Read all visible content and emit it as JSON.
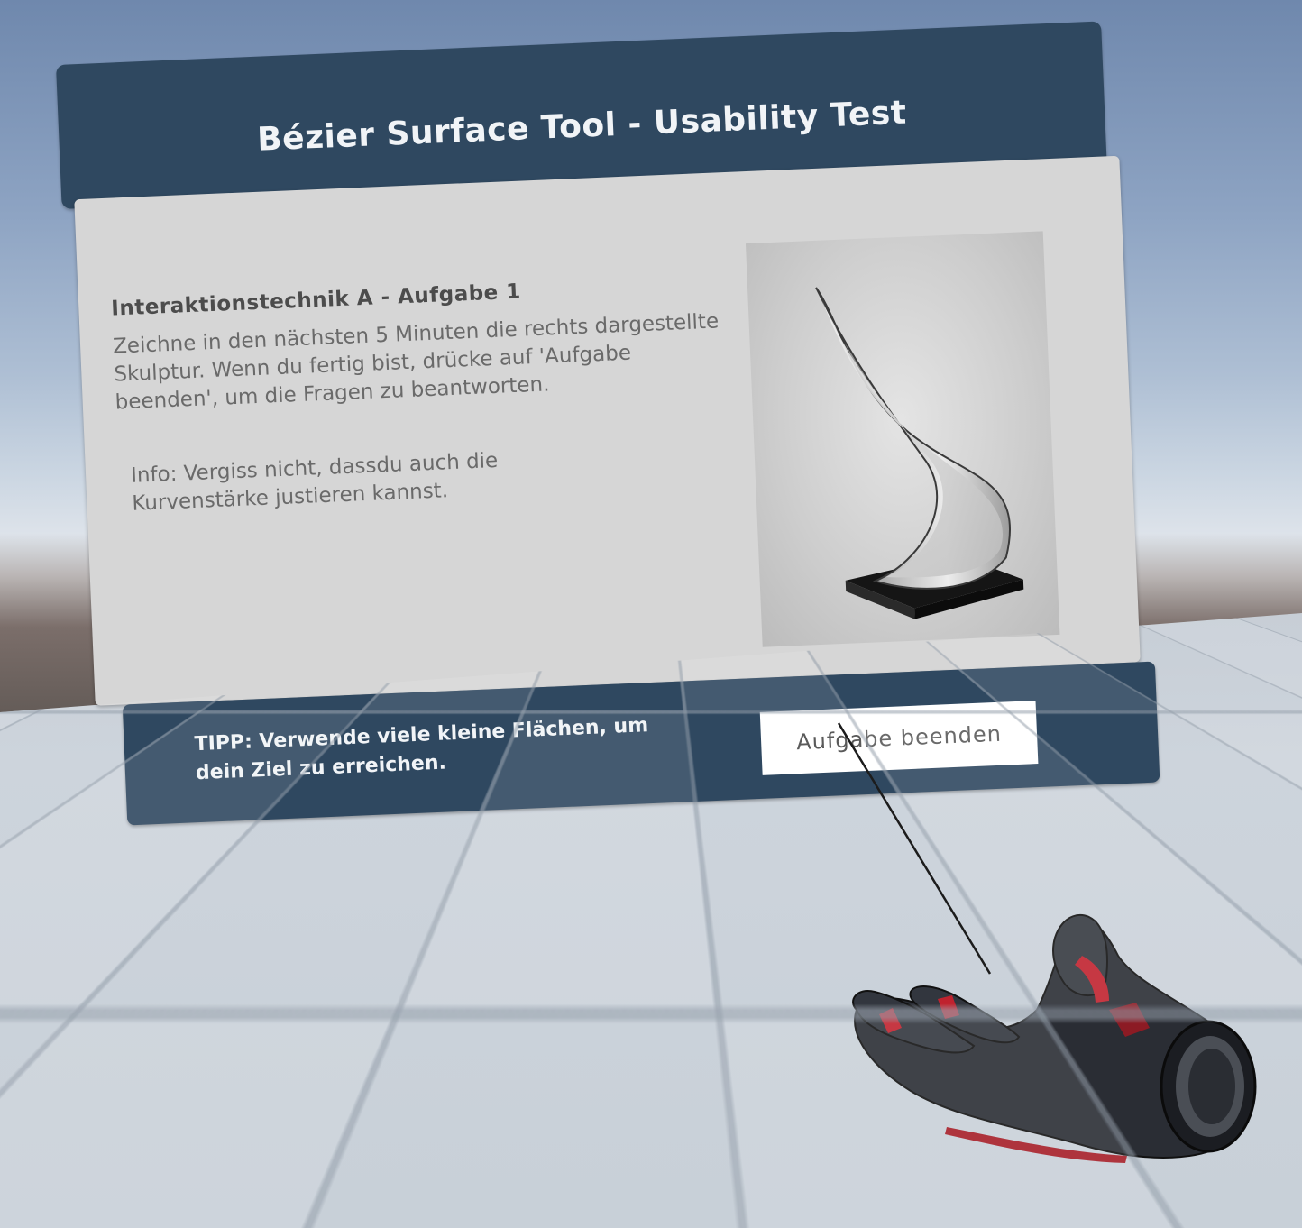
{
  "panel": {
    "title": "Bézier Surface Tool - Usability Test"
  },
  "task": {
    "heading": "Interaktionstechnik A - Aufgabe 1",
    "instruction": "Zeichne in den nächsten 5 Minuten die rechts dargestellte Skulptur. Wenn du fertig bist, drücke auf 'Aufgabe beenden', um die Fragen zu beantworten.",
    "info": "Info: Vergiss nicht, dassdu auch die Kurvenstärke justieren kannst."
  },
  "footer": {
    "tip": "TIPP: Verwende viele kleine Flächen, um dein Ziel zu erreichen.",
    "finish_button_label": "Aufgabe beenden"
  },
  "colors": {
    "panel_bar": "#2f4860",
    "panel_body": "#d6d6d6",
    "button_bg": "#ffffff"
  }
}
